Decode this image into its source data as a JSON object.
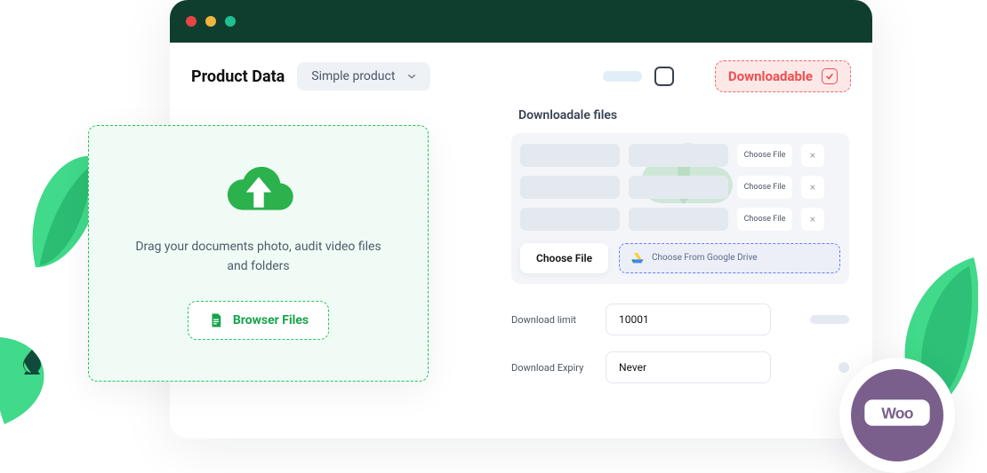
{
  "header": {
    "title": "Product Data",
    "select_value": "Simple product",
    "downloadable_label": "Downloadable"
  },
  "files": {
    "panel_title": "Downloadale files",
    "choose_file_mini": "Choose File",
    "choose_file_btn": "Choose File",
    "google_drive_btn": "Choose From Google Drive"
  },
  "download_limit": {
    "label": "Download limit",
    "value": "10001"
  },
  "download_expiry": {
    "label": "Download Expiry",
    "value": "Never"
  },
  "dropzone": {
    "instruction": "Drag your documents photo, audit video files and folders",
    "browse_label": "Browser Files"
  },
  "icons": {
    "close": "×"
  }
}
